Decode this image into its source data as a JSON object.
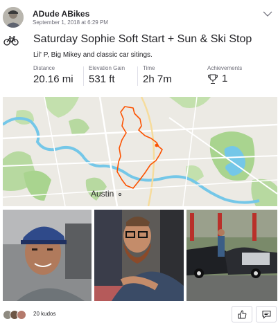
{
  "activity": {
    "athlete_name": "ADude ABikes",
    "date": "September 1, 2018 at 6:29 PM",
    "activity_type_icon": "bike-icon",
    "title": "Saturday Sophie Soft Start + Sun & Ski Stop",
    "description": "Lil' P, Big Mikey and classic car sitings."
  },
  "stats": {
    "distance": {
      "label": "Distance",
      "value": "20.16 mi"
    },
    "elevation": {
      "label": "Elevation Gain",
      "value": "531 ft"
    },
    "time": {
      "label": "Time",
      "value": "2h 7m"
    },
    "achievements": {
      "label": "Achievements",
      "value": "1",
      "icon": "trophy-icon"
    }
  },
  "map": {
    "city_label": "Austin",
    "route_color": "#fc5200",
    "water_color": "#74c7e8",
    "park_color": "#a9d48f"
  },
  "photos": [
    {
      "name": "photo-young-man-cap"
    },
    {
      "name": "photo-bearded-man-glasses"
    },
    {
      "name": "photo-classic-cars"
    }
  ],
  "footer": {
    "kudos_text": "20 kudos",
    "kudos_icon": "thumbs-up-icon",
    "comment_icon": "comment-icon"
  }
}
